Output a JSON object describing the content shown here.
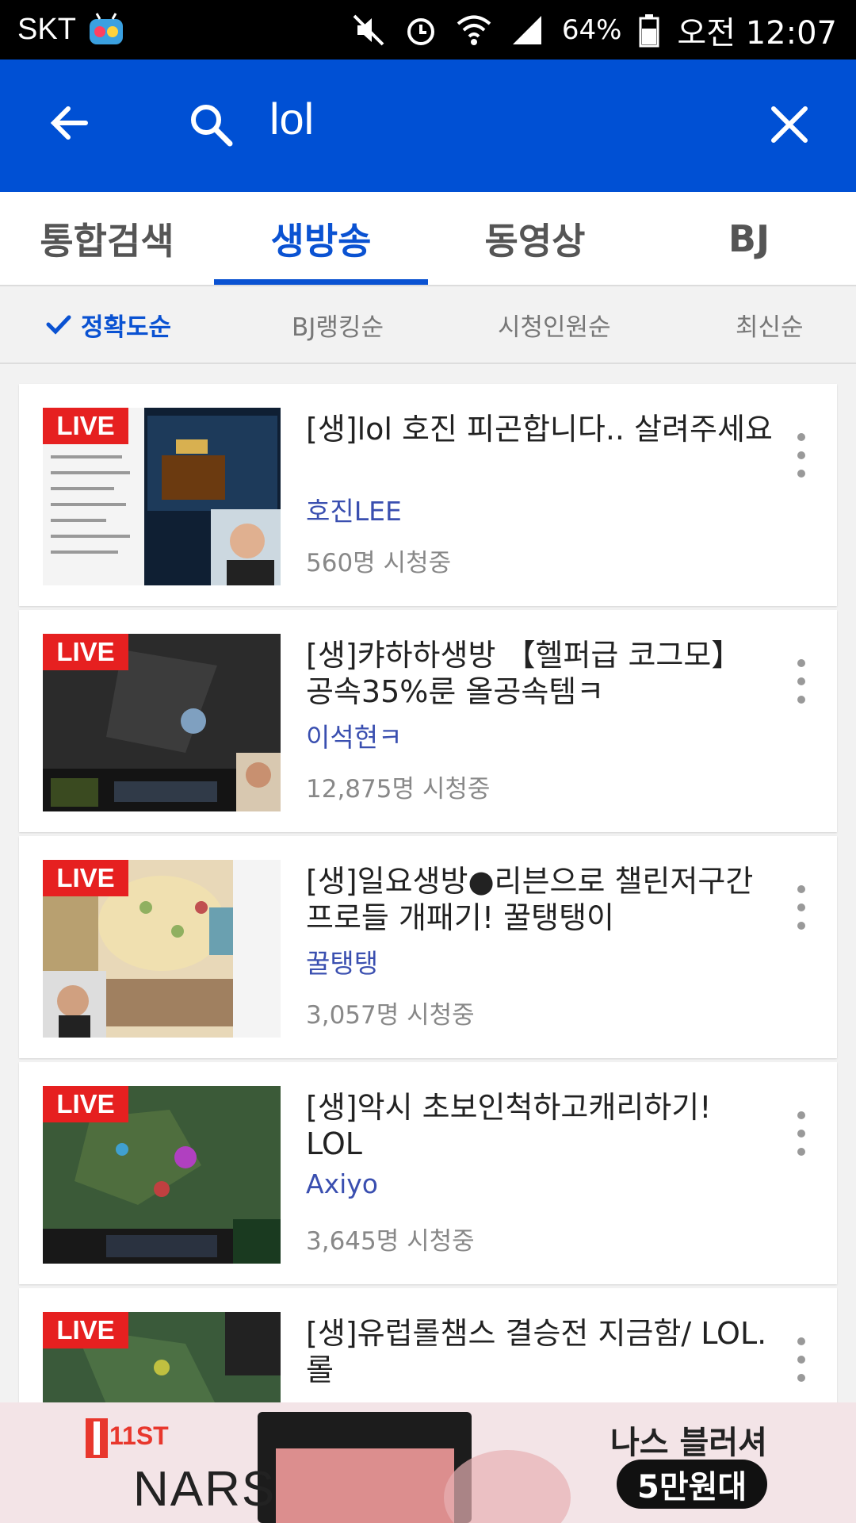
{
  "status_bar": {
    "carrier": "SKT",
    "battery": "64%",
    "time": "오전 12:07"
  },
  "search": {
    "query": "lol"
  },
  "tabs": [
    {
      "label": "통합검색",
      "active": false
    },
    {
      "label": "생방송",
      "active": true
    },
    {
      "label": "동영상",
      "active": false
    },
    {
      "label": "BJ",
      "active": false
    }
  ],
  "sort_options": [
    {
      "label": "정확도순",
      "active": true
    },
    {
      "label": "BJ랭킹순",
      "active": false
    },
    {
      "label": "시청인원순",
      "active": false
    },
    {
      "label": "최신순",
      "active": false
    }
  ],
  "live_badge": "LIVE",
  "results": [
    {
      "title": "[생]lol 호진 피곤합니다.. 살려주세요",
      "bj": "호진LEE",
      "viewers": "560명 시청중"
    },
    {
      "title": "[생]캬하하생방 【헬퍼급 코그모】 공속35%룬 올공속템ㅋ",
      "bj": "이석현ㅋ",
      "viewers": "12,875명 시청중"
    },
    {
      "title": "[생]일요생방●리븐으로 챌린저구간 프로들 개패기! 꿀탱탱이",
      "bj": "꿀탱탱",
      "viewers": "3,057명 시청중"
    },
    {
      "title": "[생]악시 초보인척하고캐리하기! LOL",
      "bj": "Axiyo",
      "viewers": "3,645명 시청중"
    },
    {
      "title": "[생]유럽롤챔스 결승전 지금함/ LOL.롤",
      "bj": "",
      "viewers": ""
    }
  ],
  "ad": {
    "store": "11ST",
    "brand": "NARS",
    "product": "나스 블러셔",
    "price": "5만원대"
  }
}
